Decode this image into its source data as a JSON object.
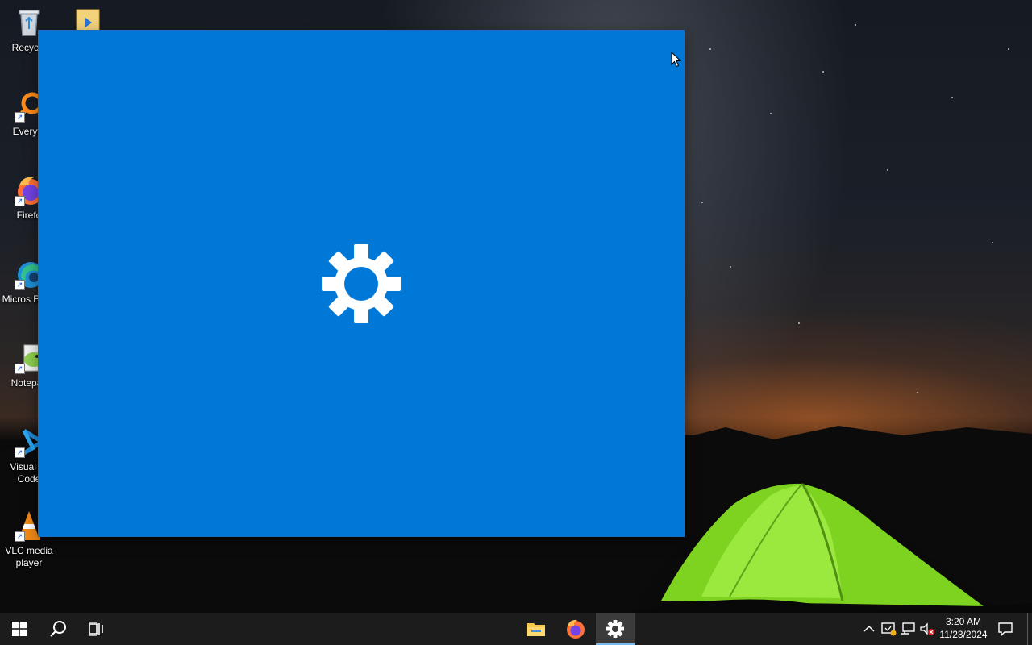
{
  "desktop": {
    "icons": [
      {
        "label": "Recycle",
        "icon": "recycle-bin-icon"
      },
      {
        "label": "Everyth",
        "icon": "everything-search-icon"
      },
      {
        "label": "Firefo",
        "icon": "firefox-icon"
      },
      {
        "label": "Micros Edge",
        "icon": "edge-icon"
      },
      {
        "label": "Notepac",
        "icon": "notepad-plus-plus-icon"
      },
      {
        "label": "Visual St Code",
        "icon": "vscode-icon"
      },
      {
        "label": "VLC media player",
        "icon": "vlc-icon"
      }
    ]
  },
  "window": {
    "app": "Settings",
    "state": "launching",
    "background_color": "#0078d7",
    "icon": "gear-icon"
  },
  "taskbar": {
    "start_icon": "windows-start-icon",
    "search_icon": "search-icon",
    "task_view_icon": "task-view-icon",
    "pinned": [
      {
        "name": "File Explorer",
        "icon": "file-explorer-icon"
      },
      {
        "name": "Firefox",
        "icon": "firefox-icon"
      },
      {
        "name": "Settings",
        "icon": "gear-icon",
        "active": true
      }
    ],
    "tray": {
      "icons": [
        "chevron-up-icon",
        "security-alert-icon",
        "network-icon",
        "volume-muted-icon"
      ],
      "time": "3:20 AM",
      "date": "11/23/2024",
      "notification_icon": "notification-icon"
    },
    "colors": {
      "background": "#1c1c1c",
      "active_app": "#3b3b3b",
      "active_indicator": "#76b9ed"
    }
  }
}
